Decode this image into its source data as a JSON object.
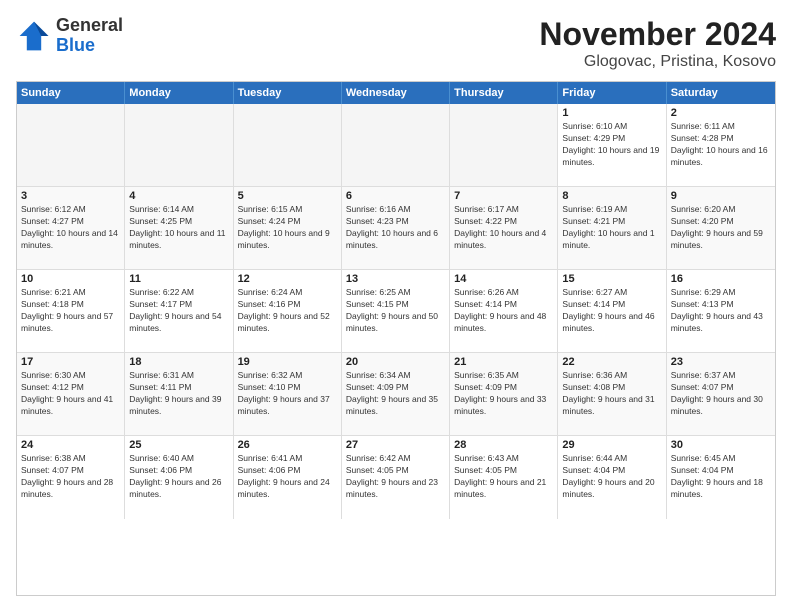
{
  "logo": {
    "general": "General",
    "blue": "Blue"
  },
  "header": {
    "month": "November 2024",
    "location": "Glogovac, Pristina, Kosovo"
  },
  "weekdays": [
    "Sunday",
    "Monday",
    "Tuesday",
    "Wednesday",
    "Thursday",
    "Friday",
    "Saturday"
  ],
  "weeks": [
    [
      {
        "day": "",
        "info": ""
      },
      {
        "day": "",
        "info": ""
      },
      {
        "day": "",
        "info": ""
      },
      {
        "day": "",
        "info": ""
      },
      {
        "day": "",
        "info": ""
      },
      {
        "day": "1",
        "info": "Sunrise: 6:10 AM\nSunset: 4:29 PM\nDaylight: 10 hours and 19 minutes."
      },
      {
        "day": "2",
        "info": "Sunrise: 6:11 AM\nSunset: 4:28 PM\nDaylight: 10 hours and 16 minutes."
      }
    ],
    [
      {
        "day": "3",
        "info": "Sunrise: 6:12 AM\nSunset: 4:27 PM\nDaylight: 10 hours and 14 minutes."
      },
      {
        "day": "4",
        "info": "Sunrise: 6:14 AM\nSunset: 4:25 PM\nDaylight: 10 hours and 11 minutes."
      },
      {
        "day": "5",
        "info": "Sunrise: 6:15 AM\nSunset: 4:24 PM\nDaylight: 10 hours and 9 minutes."
      },
      {
        "day": "6",
        "info": "Sunrise: 6:16 AM\nSunset: 4:23 PM\nDaylight: 10 hours and 6 minutes."
      },
      {
        "day": "7",
        "info": "Sunrise: 6:17 AM\nSunset: 4:22 PM\nDaylight: 10 hours and 4 minutes."
      },
      {
        "day": "8",
        "info": "Sunrise: 6:19 AM\nSunset: 4:21 PM\nDaylight: 10 hours and 1 minute."
      },
      {
        "day": "9",
        "info": "Sunrise: 6:20 AM\nSunset: 4:20 PM\nDaylight: 9 hours and 59 minutes."
      }
    ],
    [
      {
        "day": "10",
        "info": "Sunrise: 6:21 AM\nSunset: 4:18 PM\nDaylight: 9 hours and 57 minutes."
      },
      {
        "day": "11",
        "info": "Sunrise: 6:22 AM\nSunset: 4:17 PM\nDaylight: 9 hours and 54 minutes."
      },
      {
        "day": "12",
        "info": "Sunrise: 6:24 AM\nSunset: 4:16 PM\nDaylight: 9 hours and 52 minutes."
      },
      {
        "day": "13",
        "info": "Sunrise: 6:25 AM\nSunset: 4:15 PM\nDaylight: 9 hours and 50 minutes."
      },
      {
        "day": "14",
        "info": "Sunrise: 6:26 AM\nSunset: 4:14 PM\nDaylight: 9 hours and 48 minutes."
      },
      {
        "day": "15",
        "info": "Sunrise: 6:27 AM\nSunset: 4:14 PM\nDaylight: 9 hours and 46 minutes."
      },
      {
        "day": "16",
        "info": "Sunrise: 6:29 AM\nSunset: 4:13 PM\nDaylight: 9 hours and 43 minutes."
      }
    ],
    [
      {
        "day": "17",
        "info": "Sunrise: 6:30 AM\nSunset: 4:12 PM\nDaylight: 9 hours and 41 minutes."
      },
      {
        "day": "18",
        "info": "Sunrise: 6:31 AM\nSunset: 4:11 PM\nDaylight: 9 hours and 39 minutes."
      },
      {
        "day": "19",
        "info": "Sunrise: 6:32 AM\nSunset: 4:10 PM\nDaylight: 9 hours and 37 minutes."
      },
      {
        "day": "20",
        "info": "Sunrise: 6:34 AM\nSunset: 4:09 PM\nDaylight: 9 hours and 35 minutes."
      },
      {
        "day": "21",
        "info": "Sunrise: 6:35 AM\nSunset: 4:09 PM\nDaylight: 9 hours and 33 minutes."
      },
      {
        "day": "22",
        "info": "Sunrise: 6:36 AM\nSunset: 4:08 PM\nDaylight: 9 hours and 31 minutes."
      },
      {
        "day": "23",
        "info": "Sunrise: 6:37 AM\nSunset: 4:07 PM\nDaylight: 9 hours and 30 minutes."
      }
    ],
    [
      {
        "day": "24",
        "info": "Sunrise: 6:38 AM\nSunset: 4:07 PM\nDaylight: 9 hours and 28 minutes."
      },
      {
        "day": "25",
        "info": "Sunrise: 6:40 AM\nSunset: 4:06 PM\nDaylight: 9 hours and 26 minutes."
      },
      {
        "day": "26",
        "info": "Sunrise: 6:41 AM\nSunset: 4:06 PM\nDaylight: 9 hours and 24 minutes."
      },
      {
        "day": "27",
        "info": "Sunrise: 6:42 AM\nSunset: 4:05 PM\nDaylight: 9 hours and 23 minutes."
      },
      {
        "day": "28",
        "info": "Sunrise: 6:43 AM\nSunset: 4:05 PM\nDaylight: 9 hours and 21 minutes."
      },
      {
        "day": "29",
        "info": "Sunrise: 6:44 AM\nSunset: 4:04 PM\nDaylight: 9 hours and 20 minutes."
      },
      {
        "day": "30",
        "info": "Sunrise: 6:45 AM\nSunset: 4:04 PM\nDaylight: 9 hours and 18 minutes."
      }
    ]
  ]
}
